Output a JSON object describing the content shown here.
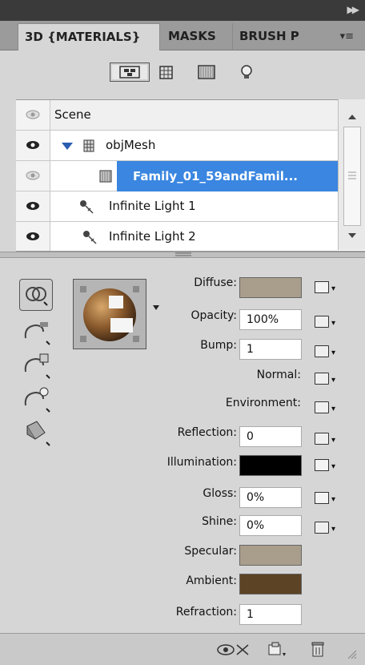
{
  "tabs": [
    {
      "label": "3D {MATERIALS}"
    },
    {
      "label": "MASKS"
    },
    {
      "label": "BRUSH P"
    }
  ],
  "filter_icons": [
    "scene-filter-icon",
    "mesh-filter-icon",
    "material-filter-icon",
    "light-filter-icon"
  ],
  "scene": {
    "rows": [
      {
        "label": "Scene"
      },
      {
        "label": "objMesh"
      },
      {
        "label": "Family_01_59andFamil..."
      },
      {
        "label": "Infinite Light 1"
      },
      {
        "label": "Infinite Light 2"
      }
    ]
  },
  "properties": {
    "diffuse": {
      "label": "Diffuse:",
      "color": "#a99e8c"
    },
    "opacity": {
      "label": "Opacity:",
      "value": "100%"
    },
    "bump": {
      "label": "Bump:",
      "value": "1"
    },
    "normal": {
      "label": "Normal:"
    },
    "environment": {
      "label": "Environment:"
    },
    "reflection": {
      "label": "Reflection:",
      "value": "0"
    },
    "illumination": {
      "label": "Illumination:",
      "color": "#000000"
    },
    "gloss": {
      "label": "Gloss:",
      "value": "0%"
    },
    "shine": {
      "label": "Shine:",
      "value": "0%"
    },
    "specular": {
      "label": "Specular:",
      "color": "#a99e8c"
    },
    "ambient": {
      "label": "Ambient:",
      "color": "#5d4325"
    },
    "refraction": {
      "label": "Refraction:",
      "value": "1"
    }
  },
  "colors": {
    "selection": "#3a86e0",
    "panel_bg": "#d6d6d6"
  }
}
